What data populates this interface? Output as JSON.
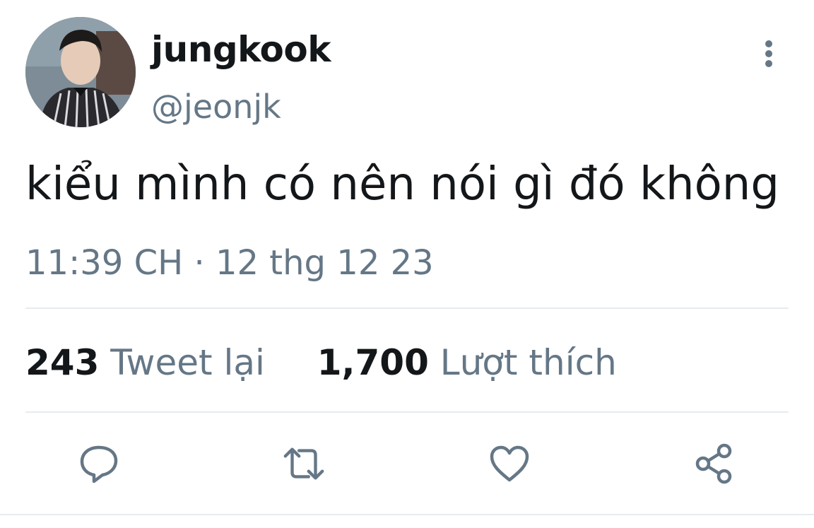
{
  "tweet": {
    "display_name": "jungkook",
    "handle": "@jeonjk",
    "text": "kiểu mình có nên nói gì đó không",
    "timestamp": "11:39 CH · 12 thg 12 23"
  },
  "stats": {
    "retweets_count": "243",
    "retweets_label": "Tweet lại",
    "likes_count": "1,700",
    "likes_label": "Lượt thích"
  },
  "icons": {
    "more": "more-vertical-icon",
    "reply": "reply-icon",
    "retweet": "retweet-icon",
    "like": "heart-icon",
    "share": "share-icon"
  },
  "colors": {
    "primary_text": "#14171a",
    "secondary_text": "#657786",
    "divider": "#e6ecf0"
  }
}
